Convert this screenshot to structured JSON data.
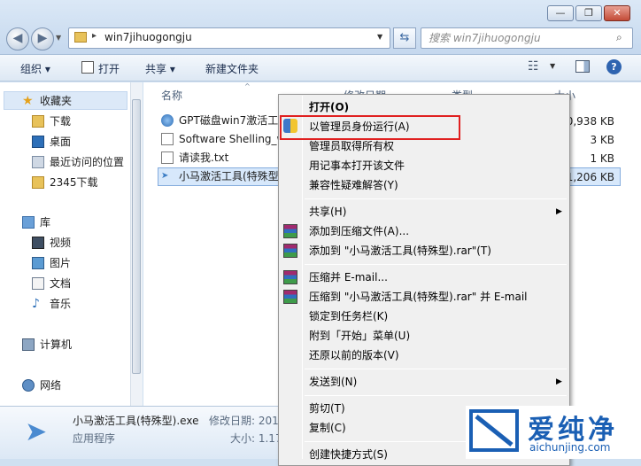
{
  "window": {
    "buttons": [
      "—",
      "❐",
      "✕"
    ]
  },
  "address": {
    "path": "win7jihuogongju",
    "search_placeholder": "搜索 win7jihuogongju"
  },
  "toolbar": {
    "organize": "组织 ▾",
    "open": "打开",
    "share": "共享 ▾",
    "new_folder": "新建文件夹"
  },
  "nav": {
    "favorites": "收藏夹",
    "downloads": "下载",
    "desktop": "桌面",
    "recent": "最近访问的位置",
    "dl2345": "2345下载",
    "libraries": "库",
    "videos": "视频",
    "pictures": "图片",
    "documents": "文档",
    "music": "音乐",
    "computer": "计算机",
    "network": "网络"
  },
  "columns": {
    "name": "名称",
    "modified": "修改日期",
    "type": "类型",
    "size": "大小"
  },
  "files": [
    {
      "name": "GPT磁盘win7激活工...",
      "size": "0,938 KB"
    },
    {
      "name": "Software Shelling_w...",
      "size": "3 KB"
    },
    {
      "name": "请读我.txt",
      "size": "1 KB"
    },
    {
      "name": "小马激活工具(特殊型...",
      "size": "1,206 KB"
    }
  ],
  "details": {
    "filename": "小马激活工具(特殊型).exe",
    "modified_label": "修改日期: 201",
    "type": "应用程序",
    "size_label": "大小: 1.17"
  },
  "menu": {
    "open": "打开(O)",
    "run_as_admin": "以管理员身份运行(A)",
    "take_ownership": "管理员取得所有权",
    "open_notepad": "用记事本打开该文件",
    "compat": "兼容性疑难解答(Y)",
    "share": "共享(H)",
    "add_archive": "添加到压缩文件(A)...",
    "add_rar": "添加到 \"小马激活工具(特殊型).rar\"(T)",
    "compress_email": "压缩并 E-mail...",
    "compress_rar_email": "压缩到 \"小马激活工具(特殊型).rar\" 并 E-mail",
    "pin_taskbar": "锁定到任务栏(K)",
    "pin_start": "附到「开始」菜单(U)",
    "restore": "还原以前的版本(V)",
    "send_to": "发送到(N)",
    "cut": "剪切(T)",
    "copy": "复制(C)",
    "create_shortcut": "创建快捷方式(S)"
  },
  "watermark": {
    "brand": "爱纯净",
    "url": "aichunjing.com"
  }
}
